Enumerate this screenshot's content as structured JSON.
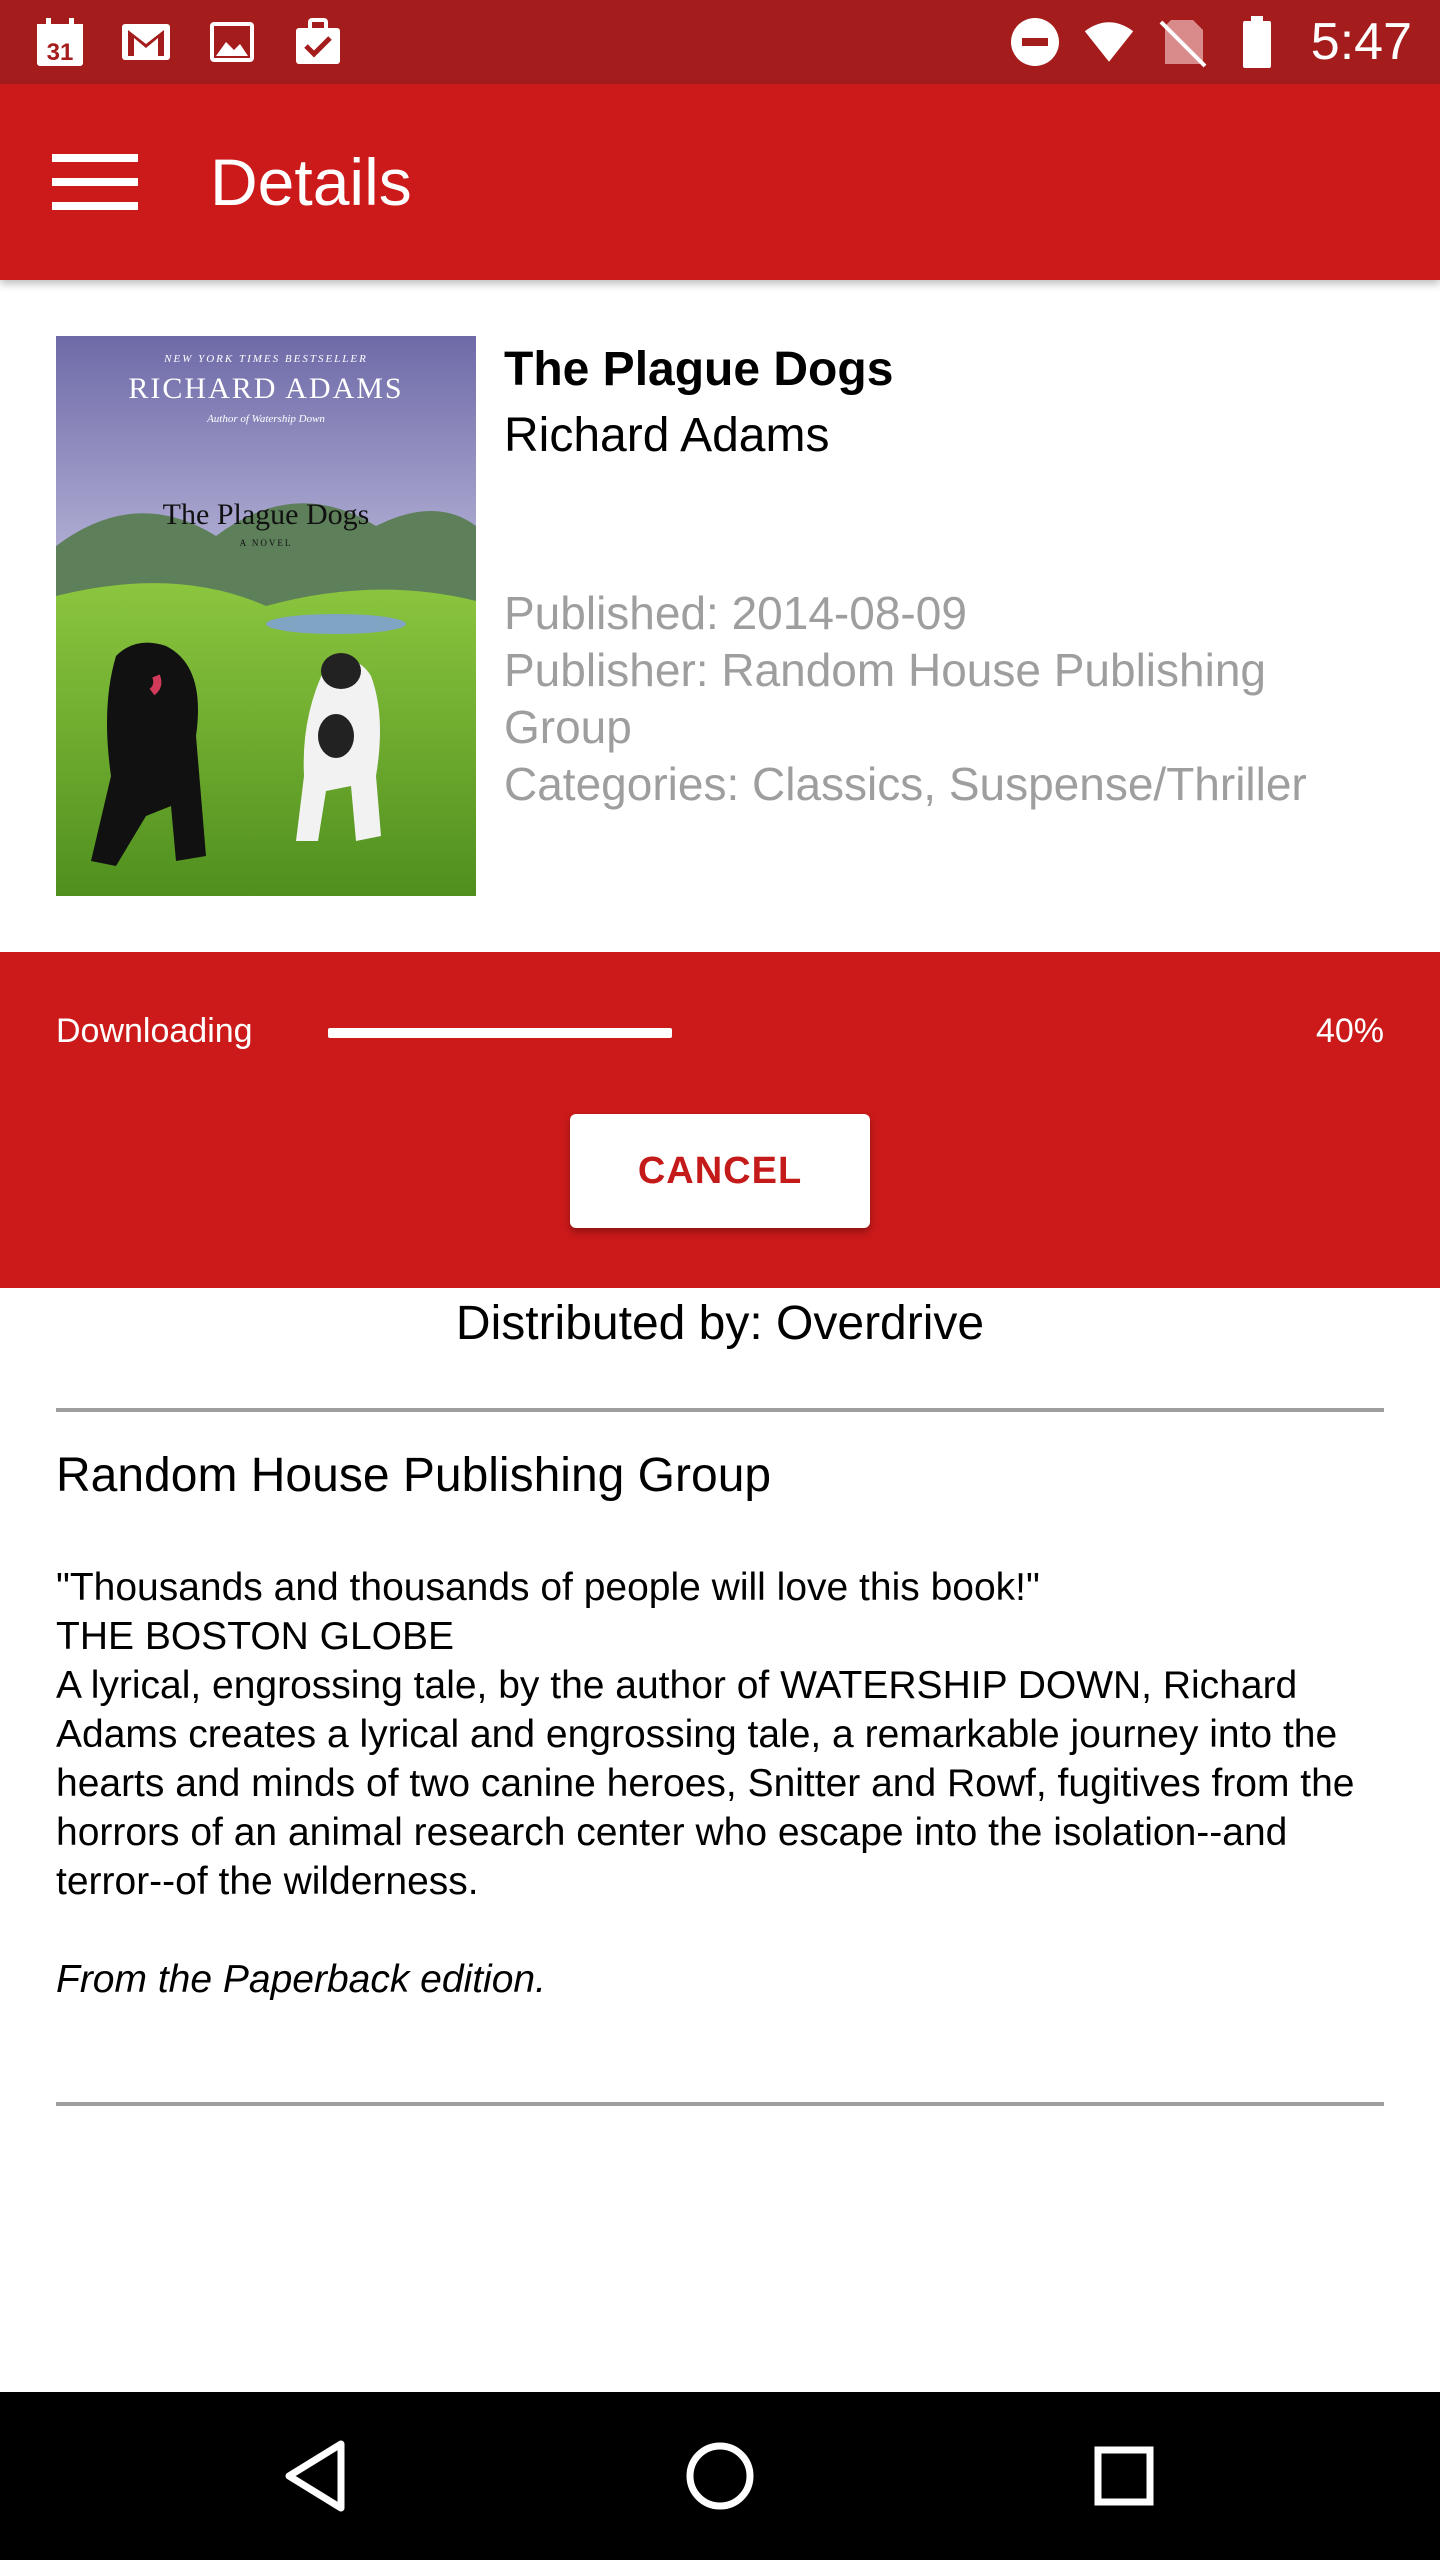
{
  "status_bar": {
    "calendar_day": "31",
    "time": "5:47",
    "icons": [
      "calendar-icon",
      "gmail-icon",
      "image-icon",
      "task-icon",
      "do-not-disturb-icon",
      "wifi-icon",
      "no-sim-icon",
      "battery-icon"
    ]
  },
  "app_bar": {
    "title": "Details",
    "menu_icon": "hamburger-menu-icon"
  },
  "book": {
    "title": "The Plague Dogs",
    "author": "Richard Adams",
    "published": "Published: 2014-08-09",
    "publisher": "Publisher: Random House Publishing Group",
    "categories": "Categories: Classics, Suspense/Thriller",
    "cover": {
      "bestseller_line": "NEW YORK TIMES BESTSELLER",
      "author": "RICHARD ADAMS",
      "byline": "Author of Watership Down",
      "title": "The Plague Dogs",
      "subtitle": "A NOVEL"
    }
  },
  "download": {
    "label": "Downloading",
    "percent_text": "40%",
    "progress": 0.4,
    "cancel_label": "CANCEL"
  },
  "distributed_by": "Distributed by: Overdrive",
  "details": {
    "publisher_heading": "Random House Publishing Group",
    "quote": "\"Thousands and thousands of people will love this book!\"",
    "quote_source": "THE BOSTON GLOBE",
    "description": "A lyrical, engrossing tale, by the author of WATERSHIP DOWN, Richard Adams creates a lyrical and engrossing tale, a remarkable journey into the hearts and minds of two canine heroes, Snitter and Rowf, fugitives from the horrors of an animal research center who escape into the isolation--and terror--of the wilderness.",
    "edition": "From the Paperback edition."
  },
  "nav_bar": {
    "icons": [
      "back-icon",
      "home-icon",
      "recents-icon"
    ]
  },
  "colors": {
    "status_bar": "#a41c1c",
    "primary": "#cc1a1a",
    "accent_text": "#c41a1a",
    "meta_text": "#9e9e9e"
  }
}
